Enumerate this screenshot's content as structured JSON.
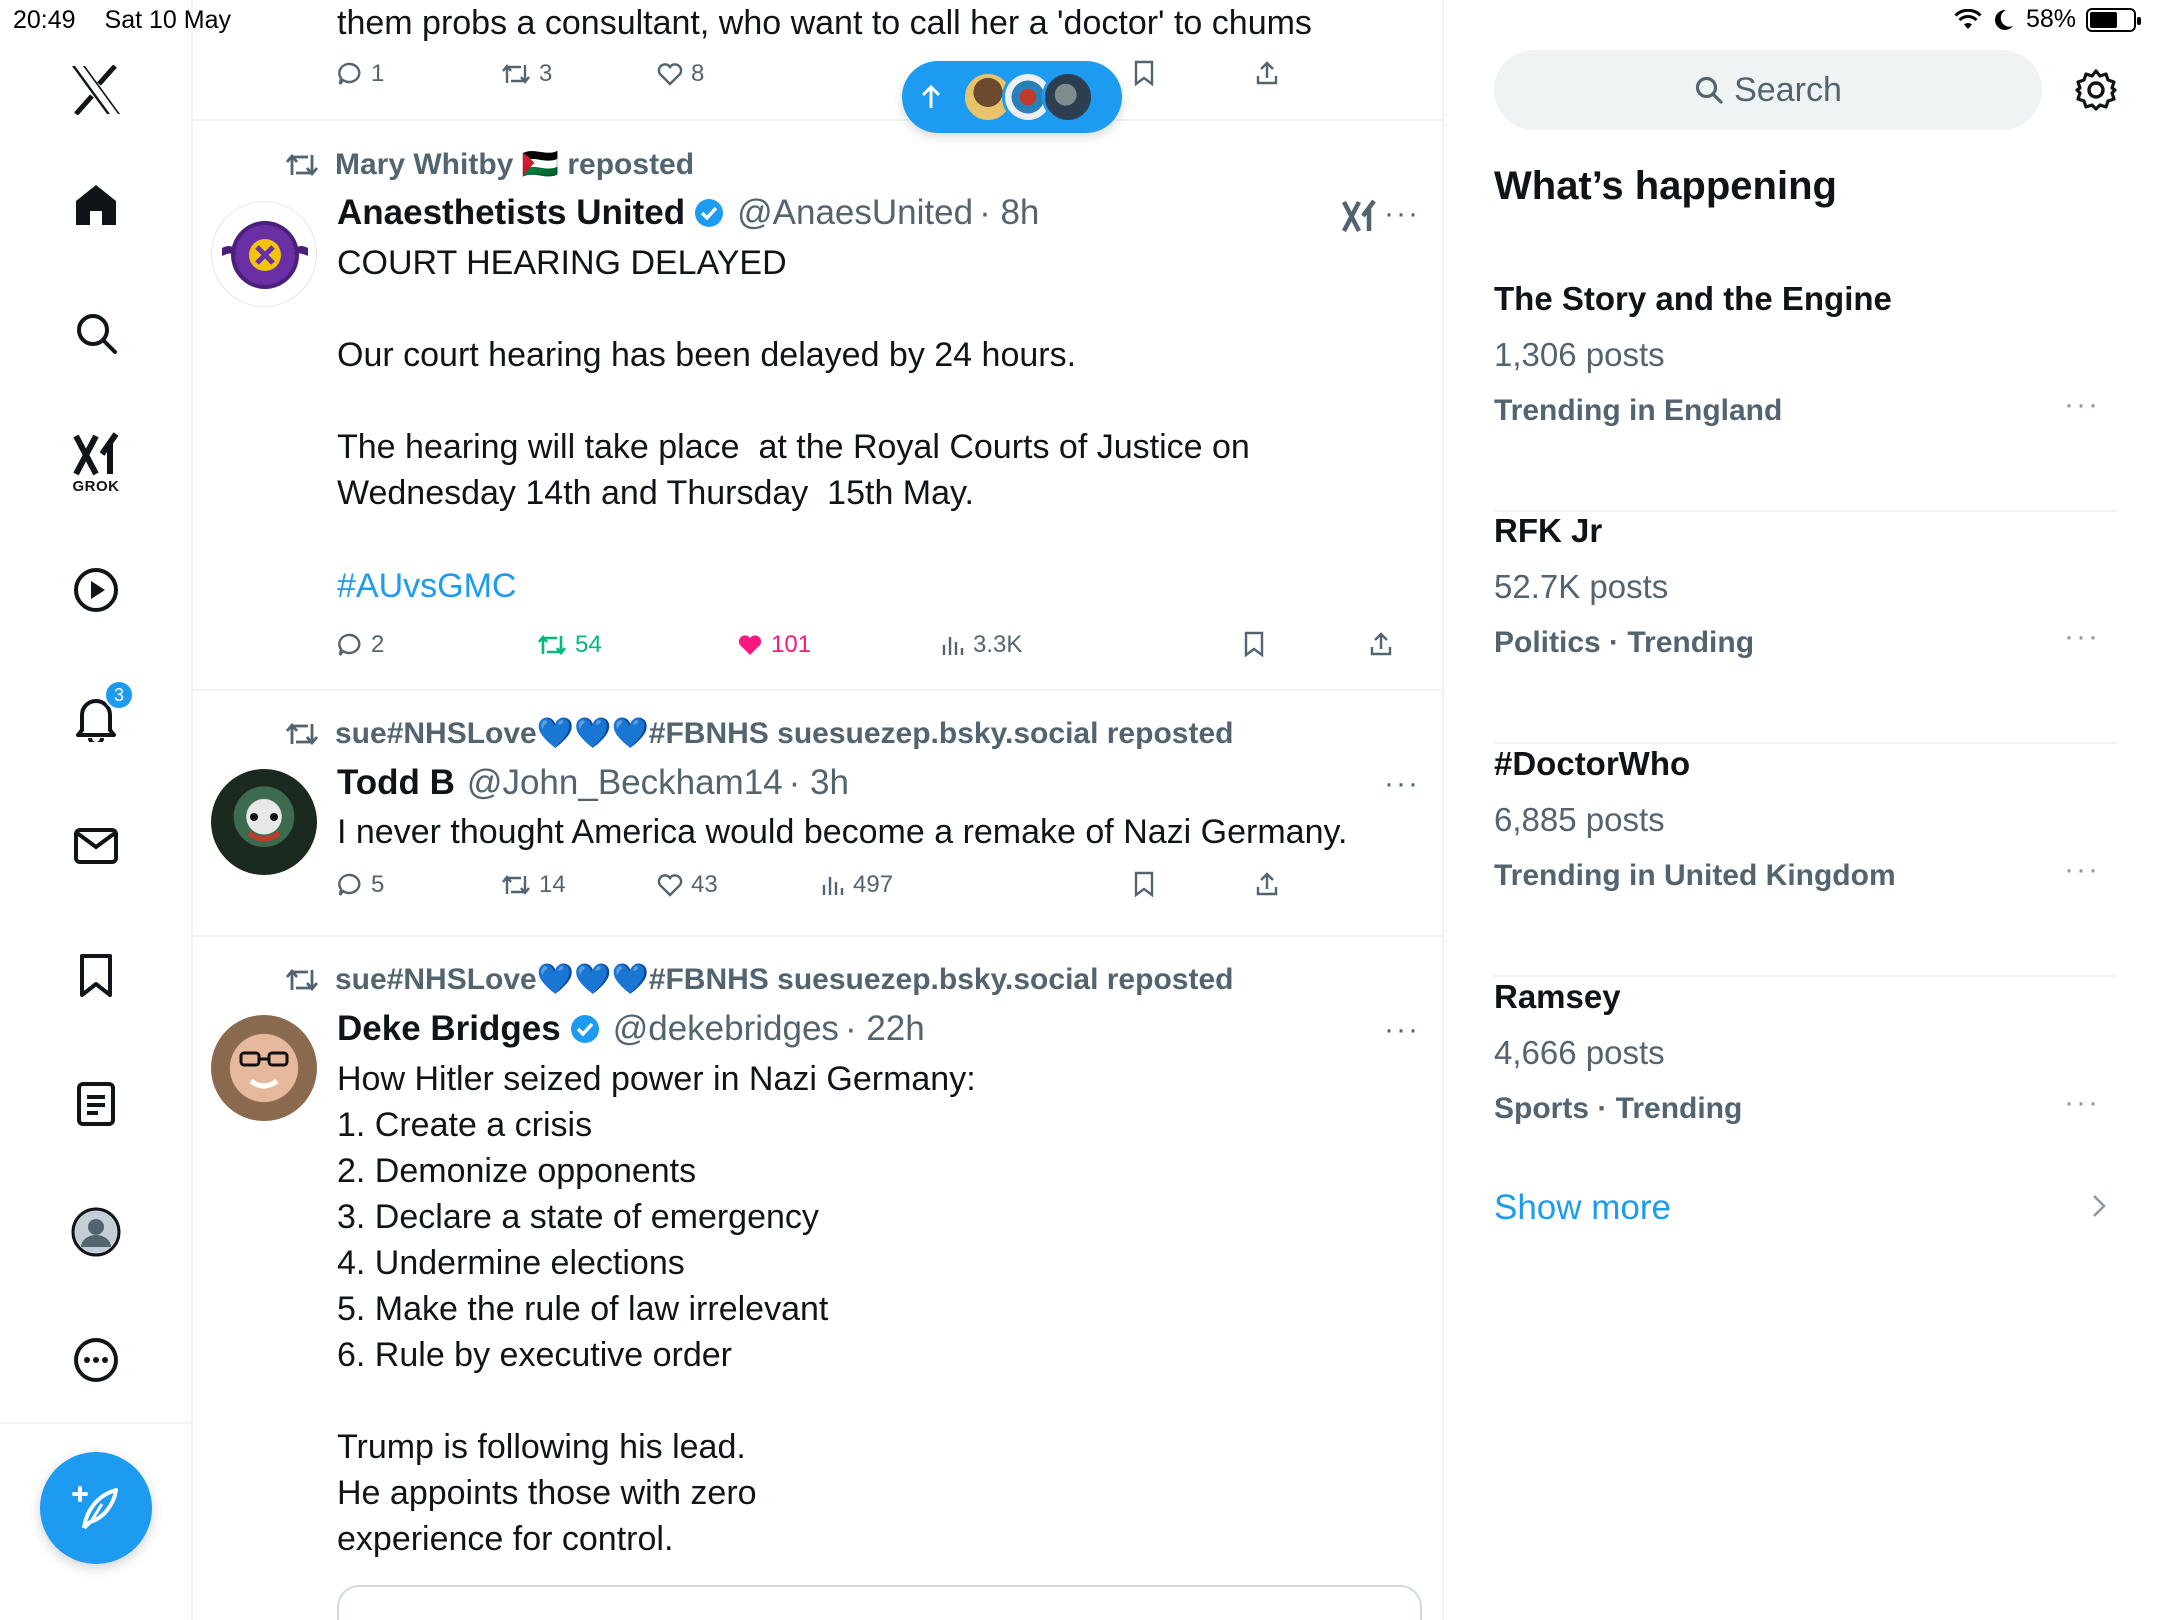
{
  "status_bar": {
    "time": "20:49",
    "date": "Sat 10 May",
    "battery": "58%",
    "battery_level": 0.58
  },
  "nav": {
    "grok_label": "GROK",
    "notification_count": "3",
    "items": [
      "x-logo-icon",
      "home-icon",
      "search-icon",
      "grok-icon",
      "video-icon",
      "bell-icon",
      "mail-icon",
      "bookmark-icon",
      "lists-icon",
      "profile-icon",
      "more-icon",
      "compose-icon"
    ]
  },
  "feed": {
    "top_post": {
      "text": "them probs a consultant, who want to call her a 'doctor' to chums",
      "replies": "1",
      "reposts": "3",
      "likes": "8"
    },
    "posts": [
      {
        "reposted_by": "Mary Whitby 🇵🇸 reposted",
        "name": "Anaesthetists United",
        "handle": "@AnaesUnited",
        "time": "· 8h",
        "verified": true,
        "body": "COURT HEARING DELAYED\n\nOur court hearing has been delayed by 24 hours.\n\nThe hearing will take place  at the Royal Courts of Justice on\nWednesday 14th and Thursday  15th May.",
        "hashtag": "#AUvsGMC",
        "replies": "2",
        "reposts": "54",
        "likes": "101",
        "views": "3.3K"
      },
      {
        "reposted_by": "sue#NHSLove💙💙💙#FBNHS suesuezep.bsky.social reposted",
        "name": "Todd B",
        "handle": "@John_Beckham14",
        "time": "· 3h",
        "verified": false,
        "body": "I never thought America would become a remake of Nazi Germany.",
        "replies": "5",
        "reposts": "14",
        "likes": "43",
        "views": "497"
      },
      {
        "reposted_by": "sue#NHSLove💙💙💙#FBNHS suesuezep.bsky.social reposted",
        "name": "Deke Bridges",
        "handle": "@dekebridges",
        "time": "· 22h",
        "verified": true,
        "body": "How Hitler seized power in Nazi Germany:\n1. Create a crisis\n2. Demonize opponents\n3. Declare a state of emergency\n4. Undermine elections\n5. Make the rule of law irrelevant\n6. Rule by executive order\n\nTrump is following his lead.\nHe appoints those with zero\nexperience for control."
      }
    ]
  },
  "sidebar": {
    "search_placeholder": "Search",
    "section_title": "What’s happening",
    "trends": [
      {
        "name": "The Story and the Engine",
        "count": "1,306 posts",
        "context": "Trending in England"
      },
      {
        "name": "RFK Jr",
        "count": "52.7K posts",
        "context": "Politics · Trending"
      },
      {
        "name": "#DoctorWho",
        "count": "6,885 posts",
        "context": "Trending in United Kingdom"
      },
      {
        "name": "Ramsey",
        "count": "4,666 posts",
        "context": "Sports · Trending"
      }
    ],
    "show_more": "Show more"
  },
  "colors": {
    "accent": "#1d9bf0",
    "repost_green": "#00ba7c",
    "like_pink": "#f91880",
    "secondary_text": "#536471"
  }
}
